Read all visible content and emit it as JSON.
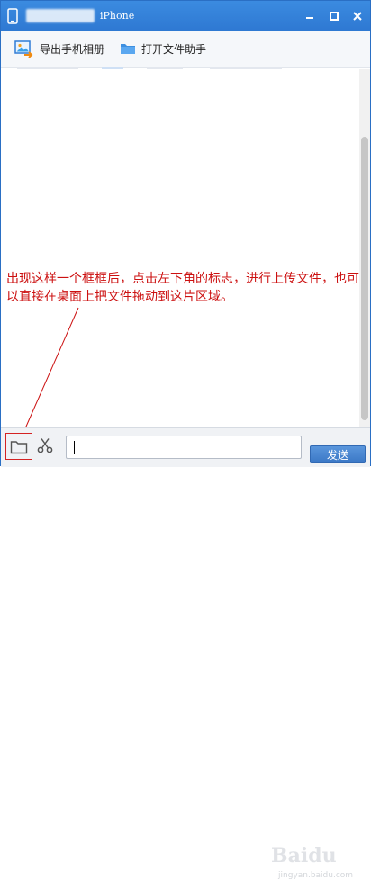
{
  "window": {
    "title": "iPhone",
    "controls": {
      "minimize_icon": "minimize-icon",
      "maximize_icon": "maximize-icon",
      "close_icon": "close-icon"
    }
  },
  "toolbar": {
    "export_label": "导出手机相册",
    "export_icon": "photo-export-icon",
    "assistant_label": "打开文件助手",
    "assistant_icon": "folder-icon"
  },
  "annotation": {
    "text": "出现这样一个框框后，点击左下角的标志，进行上传文件，也可以直接在桌面上把文件拖动到这片区域。",
    "color": "#cc1111"
  },
  "bottombar": {
    "folder_icon": "folder-icon",
    "scissors_icon": "scissors-icon",
    "input_value": "",
    "send_label": "发送"
  },
  "watermark": {
    "text": "Baidu",
    "sub": "jingyan.baidu.com"
  },
  "colors": {
    "titlebar": "#2e78d2",
    "accent": "#3b78c6",
    "annotation": "#cc1111"
  }
}
